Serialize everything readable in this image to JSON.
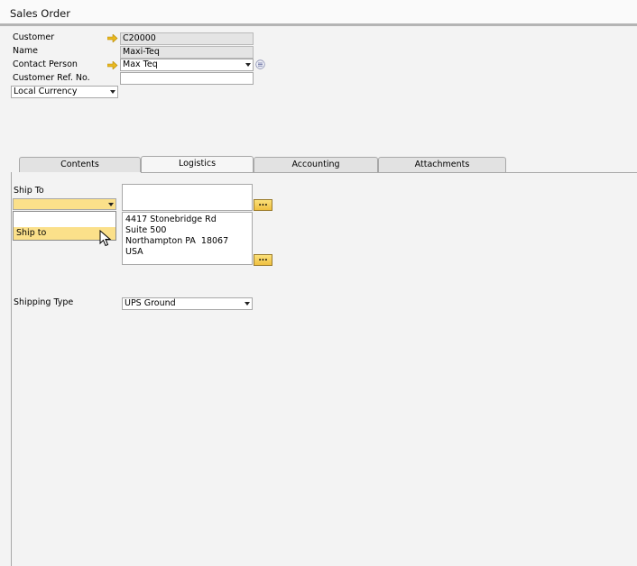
{
  "window": {
    "title": "Sales Order"
  },
  "header": {
    "customer_label": "Customer",
    "customer_value": "C20000",
    "name_label": "Name",
    "name_value": "Maxi-Teq",
    "contact_label": "Contact Person",
    "contact_value": "Max Teq",
    "ref_label": "Customer Ref. No.",
    "ref_value": "",
    "currency_value": "Local Currency"
  },
  "tabs": [
    {
      "label": "Contents"
    },
    {
      "label": "Logistics"
    },
    {
      "label": "Accounting"
    },
    {
      "label": "Attachments"
    }
  ],
  "logistics": {
    "ship_to_label": "Ship To",
    "ship_to_selected": "",
    "ship_to_options": [
      "",
      "Ship to"
    ],
    "ship_to_name": "",
    "address": "4417 Stonebridge Rd\nSuite 500\nNorthampton PA  18067\nUSA",
    "dots_label": "...",
    "shipping_type_label": "Shipping Type",
    "shipping_type_value": "UPS Ground"
  },
  "colors": {
    "accent_yellow": "#fbe08a",
    "link_arrow": "#e8b820"
  }
}
